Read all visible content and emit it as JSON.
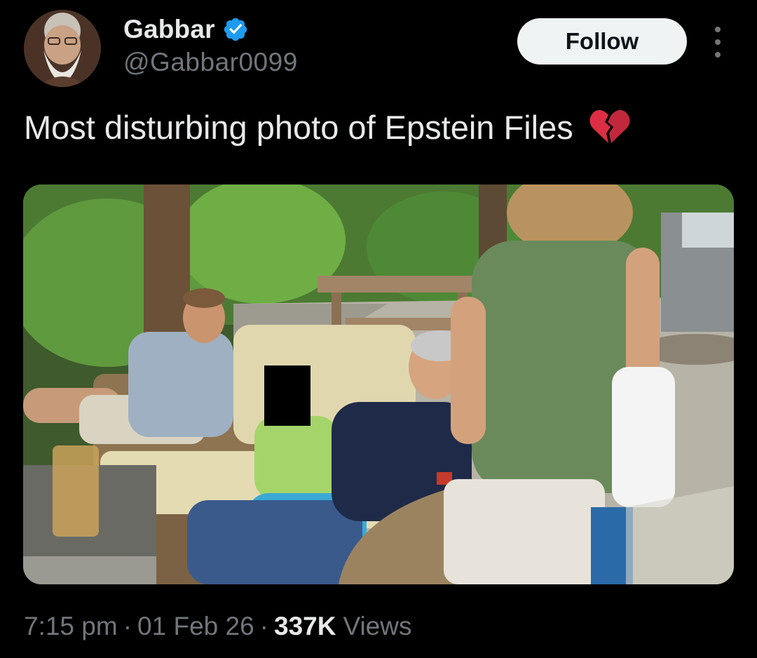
{
  "user": {
    "display_name": "Gabbar",
    "handle": "@Gabbar0099",
    "verified": true,
    "verified_color": "#1d9bf0"
  },
  "actions": {
    "follow_label": "Follow",
    "more_icon": "more-vertical-icon"
  },
  "tweet": {
    "text": "Most disturbing photo of Epstein Files",
    "emoji": "broken-heart-icon",
    "media": {
      "description_icon": "photo-image",
      "has_censor_box": true
    }
  },
  "meta": {
    "time": "7:15 pm",
    "date": "01 Feb 26",
    "separator": "·",
    "views_count": "337K",
    "views_label": "Views"
  },
  "colors": {
    "background": "#000000",
    "primary_text": "#e7e9ea",
    "secondary_text": "#71767b",
    "follow_bg": "#eff3f4"
  }
}
